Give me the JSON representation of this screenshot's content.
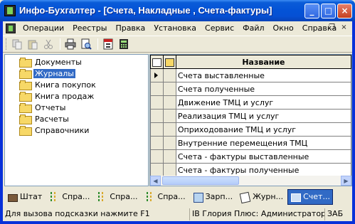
{
  "window": {
    "title": "Инфо-Бухгалтер - [Счета, Накладные , Счета-фактуры]",
    "buttons": {
      "minimize": "_",
      "maximize": "□",
      "close": "×"
    }
  },
  "menu": {
    "items": [
      "Операции",
      "Реестры",
      "Правка",
      "Установка",
      "Сервис",
      "Файл",
      "Окно",
      "Справка"
    ],
    "mdi": {
      "minimize": "_",
      "restore": "❐",
      "close": "×"
    }
  },
  "tree": {
    "items": [
      {
        "label": "Документы",
        "selected": false
      },
      {
        "label": "Журналы",
        "selected": true
      },
      {
        "label": "Книга покупок",
        "selected": false
      },
      {
        "label": "Книга продаж",
        "selected": false
      },
      {
        "label": "Отчеты",
        "selected": false
      },
      {
        "label": "Расчеты",
        "selected": false
      },
      {
        "label": "Справочники",
        "selected": false
      }
    ]
  },
  "grid": {
    "header": "Название",
    "rows": [
      "Счета выставленные",
      "Счета полученные",
      "Движение ТМЦ и услуг",
      "Реализация ТМЦ и услуг",
      "Оприходование ТМЦ и услуг",
      "Внутренние перемещения ТМЦ",
      "Счета - фактуры выставленные",
      "Счета - фактуры полученные"
    ],
    "current_row": 0
  },
  "window_tabs": [
    {
      "label": "Штат",
      "icon": "staff-icon",
      "active": false
    },
    {
      "label": "Спра...",
      "icon": "reference-icon",
      "active": false
    },
    {
      "label": "Спра...",
      "icon": "reference-icon",
      "active": false
    },
    {
      "label": "Спра...",
      "icon": "reference-icon",
      "active": false
    },
    {
      "label": "Зарп...",
      "icon": "payroll-icon",
      "active": false
    },
    {
      "label": "Журн...",
      "icon": "journal-icon",
      "active": false
    },
    {
      "label": "Счет...",
      "icon": "invoice-icon",
      "active": true
    }
  ],
  "status": {
    "hint": "Для вызова подсказки нажмите F1",
    "info": "IB Глория Плюс: Администратор",
    "mode": "ЗАБ"
  },
  "colors": {
    "titlebar": "#0453d6",
    "selection": "#316ac5",
    "face": "#ece9d8"
  }
}
